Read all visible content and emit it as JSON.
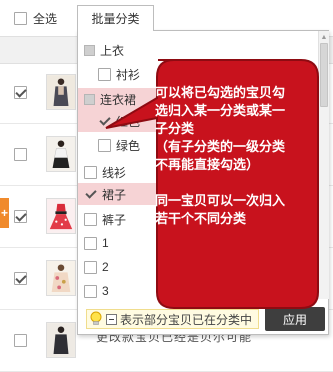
{
  "toolbar": {
    "select_all_label": "全选",
    "batch_category_label": "批量分类"
  },
  "categories": [
    {
      "label": "上衣",
      "level": 1,
      "state": "partial"
    },
    {
      "label": "衬衫",
      "level": 2,
      "state": "unchecked"
    },
    {
      "label": "连衣裙",
      "level": 1,
      "state": "partial"
    },
    {
      "label": "红色",
      "level": 2,
      "state": "checked"
    },
    {
      "label": "绿色",
      "level": 2,
      "state": "unchecked"
    },
    {
      "label": "线衫",
      "level": 1,
      "state": "unchecked"
    },
    {
      "label": "裙子",
      "level": 1,
      "state": "checked"
    },
    {
      "label": "裤子",
      "level": 1,
      "state": "unchecked"
    },
    {
      "label": "1",
      "level": 1,
      "state": "unchecked"
    },
    {
      "label": "2",
      "level": 1,
      "state": "unchecked"
    },
    {
      "label": "3",
      "level": 1,
      "state": "unchecked"
    }
  ],
  "footer": {
    "legend_text": "表示部分宝贝已在分类中",
    "apply_label": "应用"
  },
  "callout": {
    "lines": [
      "可以将已勾选的宝贝勾",
      "选归入某一分类或某一",
      "子分类",
      "（有子分类的一级分类",
      "不再能直接勾选）",
      "",
      "同一宝贝可以一次归入",
      "若干个不同分类"
    ]
  },
  "items": [
    {
      "checked": true
    },
    {
      "checked": false
    },
    {
      "checked": true
    },
    {
      "checked": true
    },
    {
      "checked": false
    }
  ],
  "bottom_text": "更改款宝贝已经是贝尔可能",
  "colors": {
    "callout_fill": "#c8121d",
    "callout_border": "#8e0b12",
    "highlight_row": "#f6d3d5",
    "apply_button": "#3e3e3e",
    "legend_bg": "#fffbe1",
    "add_tab": "#f08a2c"
  }
}
